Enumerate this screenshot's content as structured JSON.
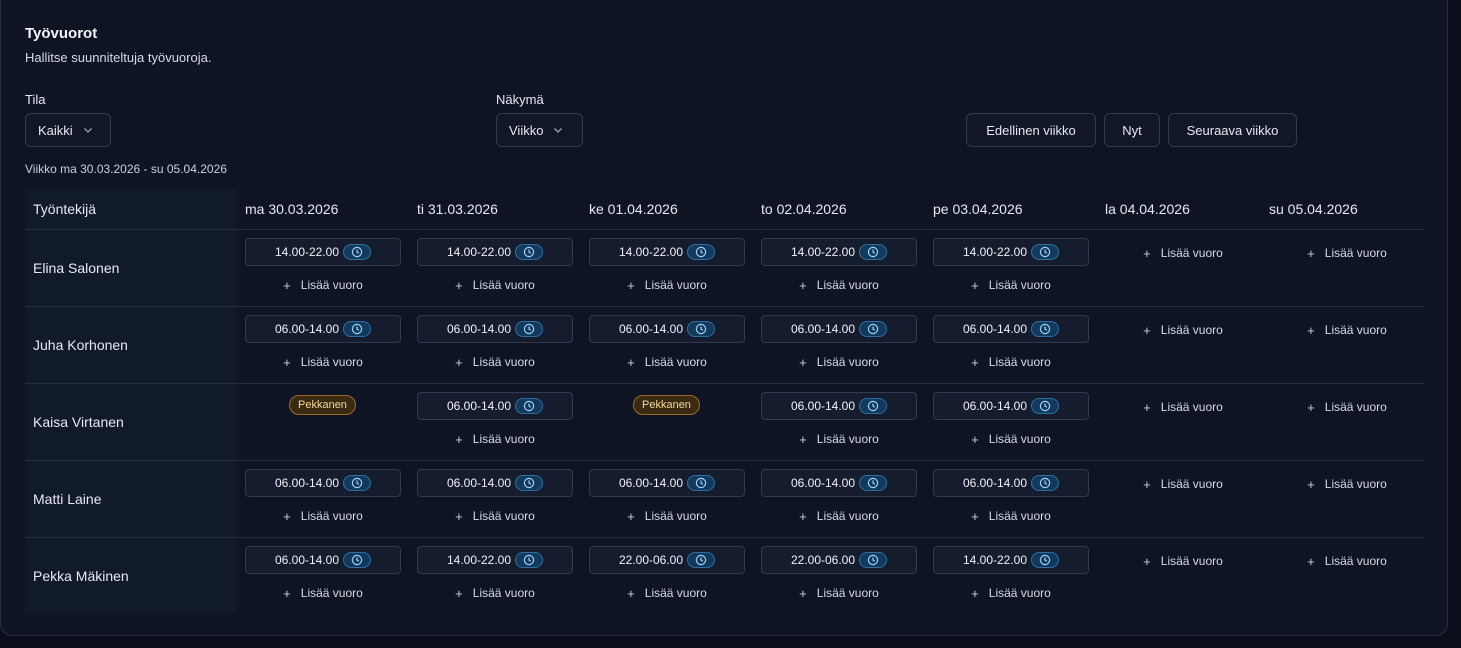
{
  "header": {
    "title": "Työvuorot",
    "subtitle": "Hallitse suunniteltuja työvuoroja."
  },
  "filters": {
    "status_label": "Tila",
    "status_value": "Kaikki",
    "view_label": "Näkymä",
    "view_value": "Viikko"
  },
  "nav": {
    "prev_label": "Edellinen viikko",
    "now_label": "Nyt",
    "next_label": "Seuraava viikko"
  },
  "week_range": "Viikko ma 30.03.2026 - su 05.04.2026",
  "table": {
    "employee_header": "Työntekijä",
    "days": [
      "ma 30.03.2026",
      "ti 31.03.2026",
      "ke 01.04.2026",
      "to 02.04.2026",
      "pe 03.04.2026",
      "la 04.04.2026",
      "su 05.04.2026"
    ],
    "add_label": "Lisää vuoro",
    "rows": [
      {
        "employee": "Elina Salonen",
        "cells": [
          {
            "type": "shift",
            "time": "14.00-22.00"
          },
          {
            "type": "shift",
            "time": "14.00-22.00"
          },
          {
            "type": "shift",
            "time": "14.00-22.00"
          },
          {
            "type": "shift",
            "time": "14.00-22.00"
          },
          {
            "type": "shift",
            "time": "14.00-22.00"
          },
          {
            "type": "empty"
          },
          {
            "type": "empty"
          }
        ]
      },
      {
        "employee": "Juha Korhonen",
        "cells": [
          {
            "type": "shift",
            "time": "06.00-14.00"
          },
          {
            "type": "shift",
            "time": "06.00-14.00"
          },
          {
            "type": "shift",
            "time": "06.00-14.00"
          },
          {
            "type": "shift",
            "time": "06.00-14.00"
          },
          {
            "type": "shift",
            "time": "06.00-14.00"
          },
          {
            "type": "empty"
          },
          {
            "type": "empty"
          }
        ]
      },
      {
        "employee": "Kaisa Virtanen",
        "cells": [
          {
            "type": "leave",
            "label": "Pekkanen"
          },
          {
            "type": "shift",
            "time": "06.00-14.00"
          },
          {
            "type": "leave",
            "label": "Pekkanen"
          },
          {
            "type": "shift",
            "time": "06.00-14.00"
          },
          {
            "type": "shift",
            "time": "06.00-14.00"
          },
          {
            "type": "empty"
          },
          {
            "type": "empty"
          }
        ]
      },
      {
        "employee": "Matti Laine",
        "cells": [
          {
            "type": "shift",
            "time": "06.00-14.00"
          },
          {
            "type": "shift",
            "time": "06.00-14.00"
          },
          {
            "type": "shift",
            "time": "06.00-14.00"
          },
          {
            "type": "shift",
            "time": "06.00-14.00"
          },
          {
            "type": "shift",
            "time": "06.00-14.00"
          },
          {
            "type": "empty"
          },
          {
            "type": "empty"
          }
        ]
      },
      {
        "employee": "Pekka Mäkinen",
        "cells": [
          {
            "type": "shift",
            "time": "06.00-14.00"
          },
          {
            "type": "shift",
            "time": "14.00-22.00"
          },
          {
            "type": "shift",
            "time": "22.00-06.00"
          },
          {
            "type": "shift",
            "time": "22.00-06.00"
          },
          {
            "type": "shift",
            "time": "14.00-22.00"
          },
          {
            "type": "empty"
          },
          {
            "type": "empty"
          }
        ]
      }
    ]
  },
  "icons": {
    "shift_badge": "clock-icon",
    "add": "plus-icon",
    "select": "chevron-down-icon"
  },
  "colors": {
    "accent_badge": "#123a5c",
    "leave_badge": "#3a2a12",
    "leave_text": "#f4d69a"
  }
}
